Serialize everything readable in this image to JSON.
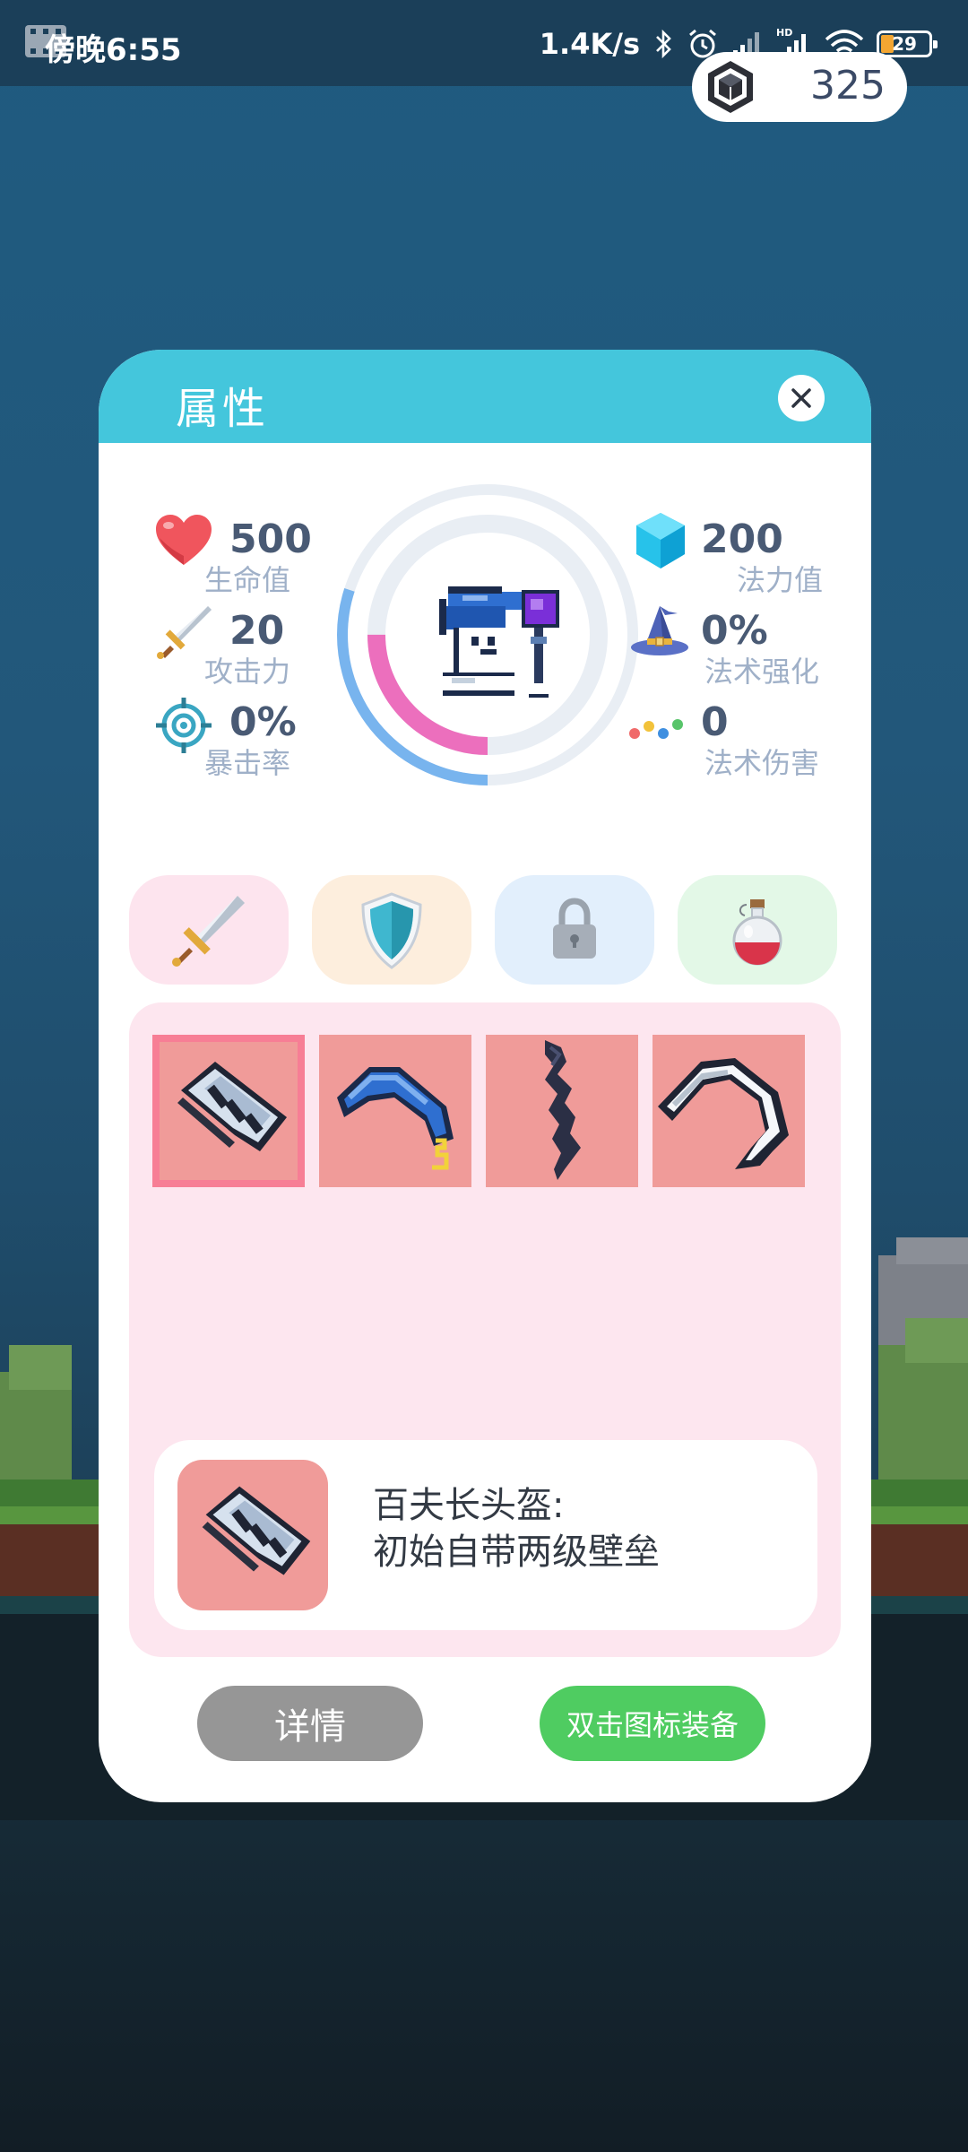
{
  "status_bar": {
    "time": "傍晚6:55",
    "network_speed": "1.4K/s",
    "battery_level": "29",
    "icons": [
      "video-icon",
      "bluetooth-icon",
      "alarm-icon",
      "signal-icon",
      "hd-signal-icon",
      "wifi-icon",
      "battery-icon"
    ]
  },
  "currency": {
    "icon": "gem-icon",
    "amount": "325"
  },
  "dialog": {
    "title": "属性",
    "close_icon": "close-icon"
  },
  "stats": {
    "left": [
      {
        "icon": "heart-icon",
        "value": "500",
        "label": "生命值"
      },
      {
        "icon": "sword-icon",
        "value": "20",
        "label": "攻击力"
      },
      {
        "icon": "crosshair-icon",
        "value": "0%",
        "label": "暴击率"
      }
    ],
    "right": [
      {
        "icon": "crystal-icon",
        "value": "200",
        "label": "法力值"
      },
      {
        "icon": "wizard-hat-icon",
        "value": "0%",
        "label": "法术强化"
      },
      {
        "icon": "colored-dots-icon",
        "value": "0",
        "label": "法术伤害"
      }
    ]
  },
  "avatar": {
    "icon": "wizard-character-icon",
    "health_ring_fraction": 0.25,
    "mana_ring_fraction": 0.3
  },
  "tabs": [
    {
      "icon": "sword-icon",
      "color": "#fde4ee"
    },
    {
      "icon": "shield-icon",
      "color": "#fdeedd"
    },
    {
      "icon": "lock-icon",
      "color": "#e2effc"
    },
    {
      "icon": "potion-icon",
      "color": "#e3f8e7"
    }
  ],
  "inventory": {
    "slots": [
      {
        "icon": "helmet-icon",
        "selected": true
      },
      {
        "icon": "blue-boomerang-icon",
        "selected": false
      },
      {
        "icon": "dark-blade-icon",
        "selected": false
      },
      {
        "icon": "white-boomerang-icon",
        "selected": false
      }
    ],
    "selected_item": {
      "icon": "helmet-icon",
      "name": "百夫长头盔:",
      "description": "初始自带两级壁垒"
    }
  },
  "buttons": {
    "details_label": "详情",
    "equip_label": "双击图标装备"
  },
  "colors": {
    "header": "#44c6dc",
    "stat_value": "#495a74",
    "stat_label": "#9fb0c8",
    "slot_bg": "#f09b99",
    "panel_bg": "#fde6ef",
    "details_button": "#969696",
    "equip_button": "#4fcc61"
  }
}
